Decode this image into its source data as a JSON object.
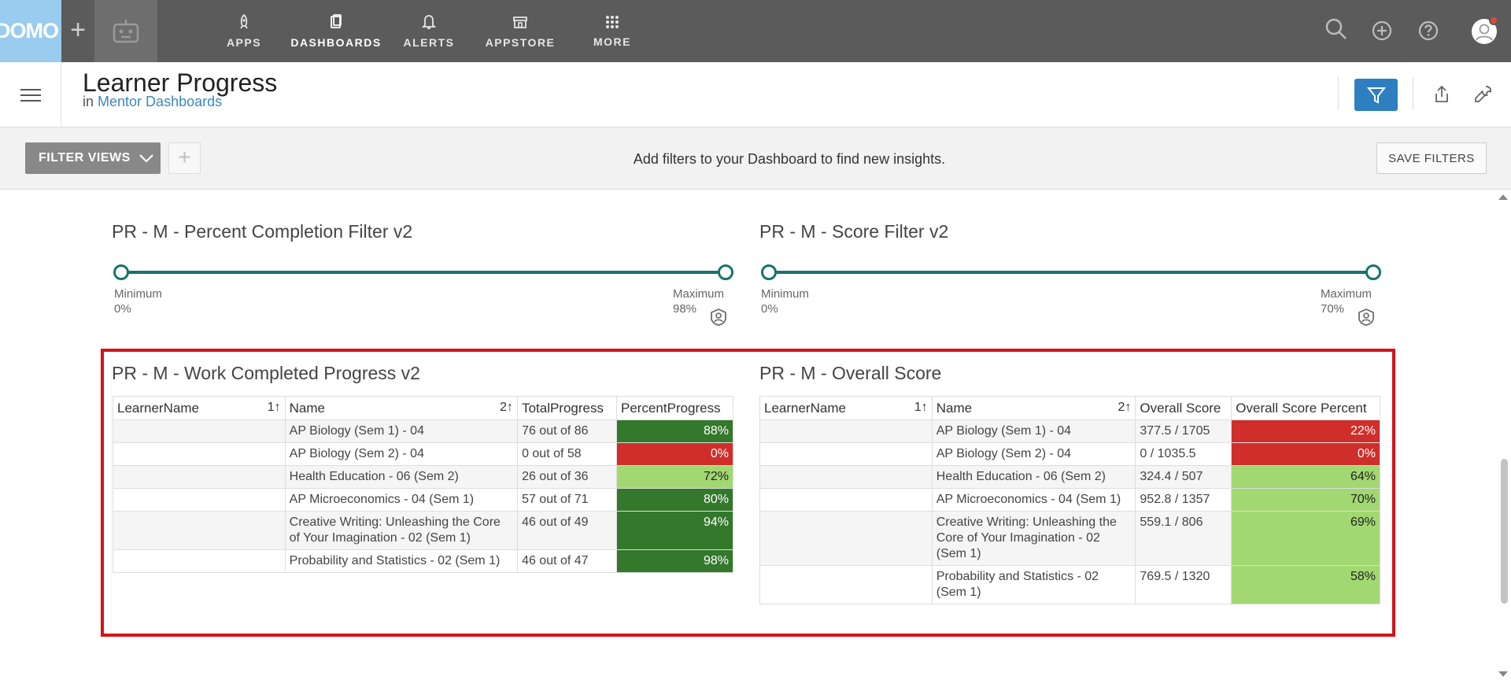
{
  "nav": {
    "logo": "DOMO",
    "items": [
      {
        "label": "APPS",
        "icon": "rocket-icon"
      },
      {
        "label": "DASHBOARDS",
        "icon": "dashboard-icon"
      },
      {
        "label": "ALERTS",
        "icon": "bell-icon"
      },
      {
        "label": "APPSTORE",
        "icon": "store-icon"
      },
      {
        "label": "MORE",
        "icon": "grid-icon"
      }
    ],
    "active": "DASHBOARDS"
  },
  "header": {
    "title": "Learner Progress",
    "sub_prefix": "in",
    "sub_link": "Mentor Dashboards"
  },
  "filterbar": {
    "filter_views": "FILTER VIEWS",
    "message": "Add filters to your Dashboard to find new insights.",
    "save": "SAVE FILTERS"
  },
  "filters": [
    {
      "title": "PR - M - Percent Completion Filter v2",
      "min_label": "Minimum",
      "min_value": "0%",
      "max_label": "Maximum",
      "max_value": "98%"
    },
    {
      "title": "PR - M - Score Filter v2",
      "min_label": "Minimum",
      "min_value": "0%",
      "max_label": "Maximum",
      "max_value": "70%"
    }
  ],
  "tables": [
    {
      "title": "PR - M - Work Completed Progress v2",
      "columns": [
        "LearnerName",
        "Name",
        "TotalProgress",
        "PercentProgress"
      ],
      "sort1": "1↑",
      "sort2": "2↑",
      "rows": [
        {
          "name": "AP Biology (Sem 1) - 04",
          "value": "76 out of 86",
          "pct": "88%"
        },
        {
          "name": "AP Biology (Sem 2) - 04",
          "value": "0 out of 58",
          "pct": "0%"
        },
        {
          "name": "Health Education - 06 (Sem 2)",
          "value": "26 out of 36",
          "pct": "72%"
        },
        {
          "name": "AP Microeconomics - 04 (Sem 1)",
          "value": "57 out of 71",
          "pct": "80%"
        },
        {
          "name": "Creative Writing: Unleashing the Core of Your Imagination - 02 (Sem 1)",
          "value": "46 out of 49",
          "pct": "94%"
        },
        {
          "name": "Probability and Statistics - 02 (Sem 1)",
          "value": "46 out of 47",
          "pct": "98%"
        }
      ]
    },
    {
      "title": "PR - M - Overall Score",
      "columns": [
        "LearnerName",
        "Name",
        "Overall Score",
        "Overall Score Percent"
      ],
      "sort1": "1↑",
      "sort2": "2↑",
      "rows": [
        {
          "name": "AP Biology (Sem 1) - 04",
          "value": "377.5 / 1705",
          "pct": "22%"
        },
        {
          "name": "AP Biology (Sem 2) - 04",
          "value": "0 / 1035.5",
          "pct": "0%"
        },
        {
          "name": "Health Education - 06 (Sem 2)",
          "value": "324.4 / 507",
          "pct": "64%"
        },
        {
          "name": "AP Microeconomics - 04 (Sem 1)",
          "value": "952.8 / 1357",
          "pct": "70%"
        },
        {
          "name": "Creative Writing: Unleashing the Core of Your Imagination - 02 (Sem 1)",
          "value": "559.1 / 806",
          "pct": "69%"
        },
        {
          "name": "Probability and Statistics - 02 (Sem 1)",
          "value": "769.5 / 1320",
          "pct": "58%"
        }
      ]
    }
  ],
  "colors": {
    "nav_bg": "#5b5b5b",
    "logo_bg": "#99ccee",
    "accent": "#2d7fc0",
    "slider": "#16736f",
    "dark_green": "#33782b",
    "light_green": "#a1d871",
    "red": "#cf2e2a",
    "highlight": "#d2141b"
  }
}
